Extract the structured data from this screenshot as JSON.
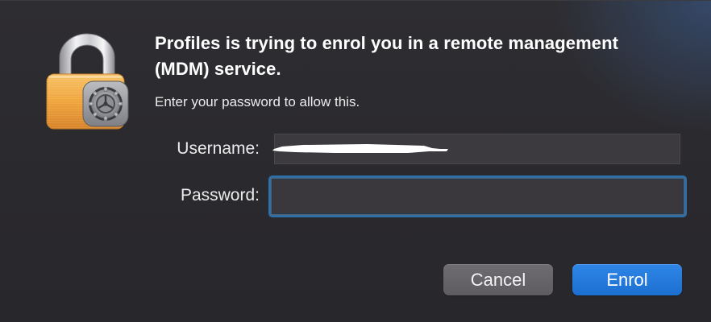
{
  "dialog": {
    "title": "Profiles is trying to enrol you in a remote management (MDM) service.",
    "message": "Enter your password to allow this.",
    "icon": "lock-icon",
    "badge_icon": "system-preferences-gear-icon"
  },
  "form": {
    "username_label": "Username:",
    "username_value": "",
    "username_redacted": true,
    "password_label": "Password:",
    "password_value": ""
  },
  "buttons": {
    "cancel_label": "Cancel",
    "enrol_label": "Enrol"
  },
  "colors": {
    "background": "#2a292d",
    "accent": "#1c6fd0",
    "focus_ring": "#2d6fa8",
    "lock_gold": "#f0a33c"
  }
}
